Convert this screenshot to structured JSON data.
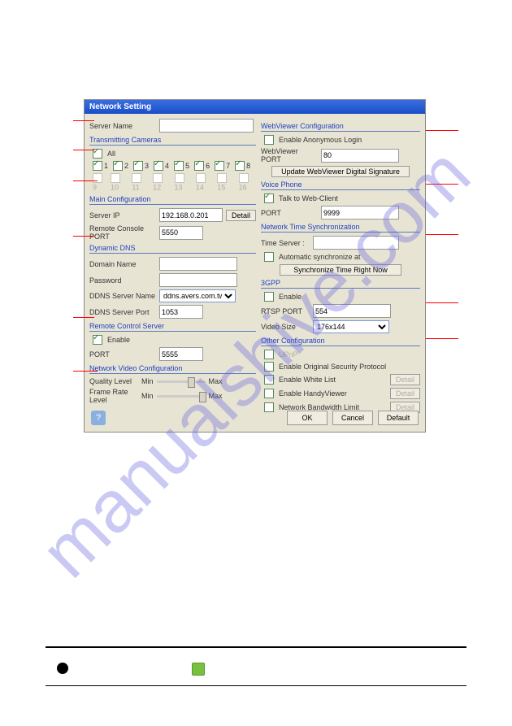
{
  "watermark": "manualshive.com",
  "title": "Network Setting",
  "left": {
    "server_name_label": "Server Name",
    "transmitting_cameras": "Transmitting Cameras",
    "all_label": "All",
    "cam_enabled": [
      "1",
      "2",
      "3",
      "4",
      "5",
      "6",
      "7",
      "8"
    ],
    "cam_disabled": [
      "9",
      "10",
      "11",
      "12",
      "13",
      "14",
      "15",
      "16"
    ],
    "main_config": "Main Configuration",
    "server_ip_label": "Server IP",
    "server_ip": "192.168.0.201",
    "detail_btn": "Detail",
    "remote_port_label": "Remote Console PORT",
    "remote_port": "5550",
    "dyn_dns": "Dynamic DNS",
    "domain_label": "Domain Name",
    "pwd_label": "Password",
    "ddns_server_label": "DDNS Server Name",
    "ddns_server": "ddns.avers.com.tw",
    "ddns_port_label": "DDNS Server Port",
    "ddns_port": "1053",
    "rcs": "Remote Control Server",
    "enable_label": "Enable",
    "port_label": "PORT",
    "rcs_port": "5555",
    "nvc": "Network Video Configuration",
    "quality_label": "Quality Level",
    "frame_label": "Frame Rate Level",
    "min": "Min",
    "max": "Max"
  },
  "right": {
    "webviewer": "WebViewer Configuration",
    "anon_label": "Enable Anonymous Login",
    "wv_port_label": "WebViewer PORT",
    "wv_port": "80",
    "update_btn": "Update WebViewer Digital Signature",
    "voice": "Voice Phone",
    "talk_label": "Talk to Web-Client",
    "port_label": "PORT",
    "voice_port": "9999",
    "nts": "Network Time Synchronization",
    "ts_label": "Time Server :",
    "auto_label": "Automatic synchronize at",
    "sync_btn": "Synchronize Time Right Now",
    "gpp": "3GPP",
    "gpp_enable": "Enable",
    "rtsp_label": "RTSP PORT",
    "rtsp_port": "554",
    "vsize_label": "Video Size",
    "vsize": "176x144",
    "other": "Other Configuration",
    "upnp": "UPnP",
    "sec_proto": "Enable Original Security Protocol",
    "whitelist": "Enable White List",
    "handy": "Enable HandyViewer",
    "bw": "Network Bandwidth Limit",
    "detail_btn": "Detail"
  },
  "buttons": {
    "ok": "OK",
    "cancel": "Cancel",
    "default": "Default"
  }
}
